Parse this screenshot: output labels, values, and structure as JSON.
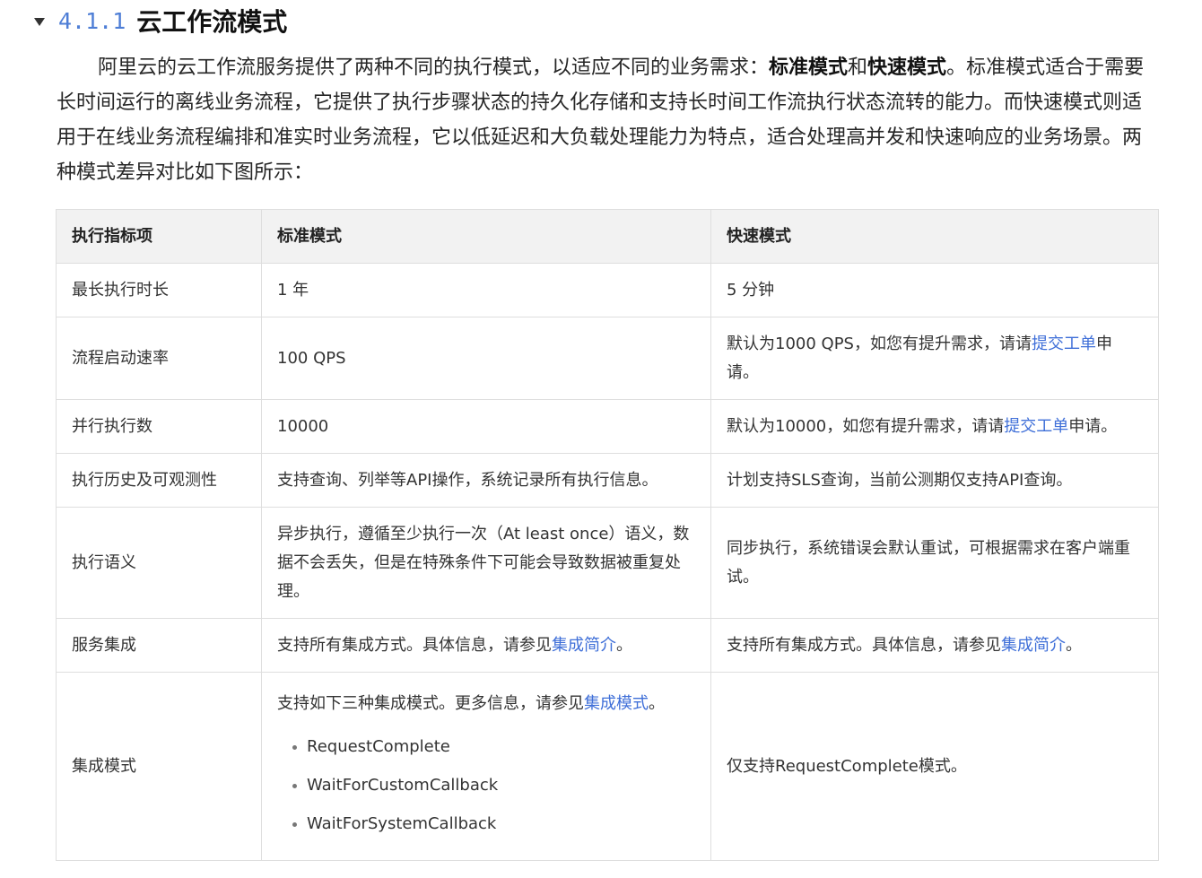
{
  "section": {
    "number": "4.1.1",
    "title": "云工作流模式"
  },
  "intro": {
    "part1": "阿里云的云工作流服务提供了两种不同的执行模式，以适应不同的业务需求：",
    "bold1": "标准模式",
    "part2": "和",
    "bold2": "快速模式",
    "part3": "。标准模式适合于需要长时间运行的离线业务流程，它提供了执行步骤状态的持久化存储和支持长时间工作流执行状态流转的能力。而快速模式则适用于在线业务流程编排和准实时业务流程，它以低延迟和大负载处理能力为特点，适合处理高并发和快速响应的业务场景。两种模式差异对比如下图所示："
  },
  "table": {
    "headers": [
      "执行指标项",
      "标准模式",
      "快速模式"
    ],
    "rows": [
      {
        "metric": "最长执行时长",
        "standard": "1 年",
        "express": "5 分钟"
      },
      {
        "metric": "流程启动速率",
        "standard": "100 QPS",
        "express_pre": "默认为1000 QPS，如您有提升需求，请请",
        "express_link": "提交工单",
        "express_post": "申请。"
      },
      {
        "metric": "并行执行数",
        "standard": "10000",
        "express_pre": "默认为10000，如您有提升需求，请请",
        "express_link": "提交工单",
        "express_post": "申请。"
      },
      {
        "metric": "执行历史及可观测性",
        "standard": "支持查询、列举等API操作，系统记录所有执行信息。",
        "express": "计划支持SLS查询，当前公测期仅支持API查询。"
      },
      {
        "metric": "执行语义",
        "standard": "异步执行，遵循至少执行一次（At least once）语义，数据不会丢失，但是在特殊条件下可能会导致数据被重复处理。",
        "express": "同步执行，系统错误会默认重试，可根据需求在客户端重试。"
      },
      {
        "metric": "服务集成",
        "standard_pre": "支持所有集成方式。具体信息，请参见",
        "standard_link": "集成简介",
        "standard_post": "。",
        "express_pre": "支持所有集成方式。具体信息，请参见",
        "express_link": "集成简介",
        "express_post": "。"
      },
      {
        "metric": "集成模式",
        "standard_pre": "支持如下三种集成模式。更多信息，请参见",
        "standard_link": "集成模式",
        "standard_post": "。",
        "standard_list": [
          "RequestComplete",
          "WaitForCustomCallback",
          "WaitForSystemCallback"
        ],
        "express": "仅支持RequestComplete模式。"
      }
    ]
  },
  "icons": {
    "collapse": "caret-down-icon",
    "list_bullet": "bullet-dot-icon"
  },
  "colors": {
    "section_number": "#4e7ed6",
    "link": "#3f6fd8",
    "header_bg": "#f2f2f2",
    "border": "#dedede"
  }
}
